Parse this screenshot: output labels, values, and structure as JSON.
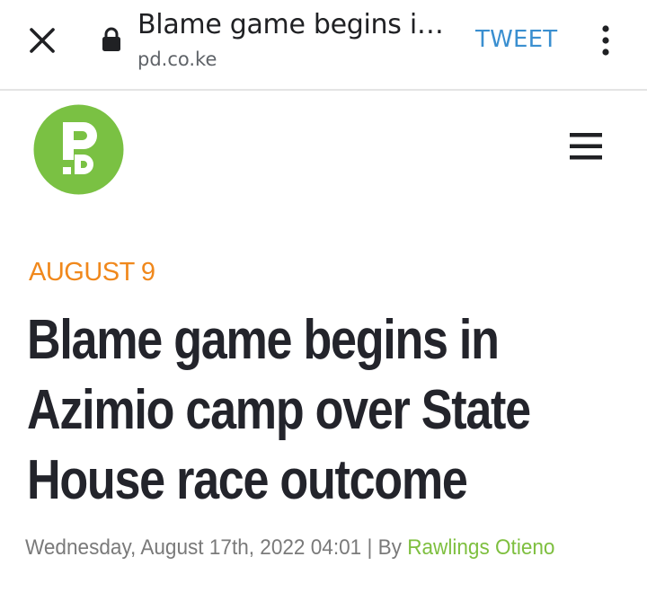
{
  "browser": {
    "title": "Blame game begins i…",
    "domain": "pd.co.ke",
    "tweet_label": "TWEET",
    "icons": {
      "close": "close-icon",
      "lock": "lock-icon",
      "more": "more-vert-icon"
    }
  },
  "site": {
    "logo_text": "PD",
    "logo_color": "#7ac143",
    "icons": {
      "menu": "hamburger-menu-icon"
    }
  },
  "article": {
    "date_tag": "AUGUST 9",
    "headline_lines": [
      "Blame game begins in",
      "Azimio camp over State",
      "House race outcome"
    ],
    "byline": {
      "date": "Wednesday, August 17th, 2022 04:01",
      "separator": "|",
      "by_label": "By",
      "author": "Rawlings Otieno"
    }
  },
  "colors": {
    "accent_orange": "#f0881c",
    "link_blue": "#3a8fd0",
    "author_green": "#7ebf3f",
    "headline": "#23242b"
  }
}
